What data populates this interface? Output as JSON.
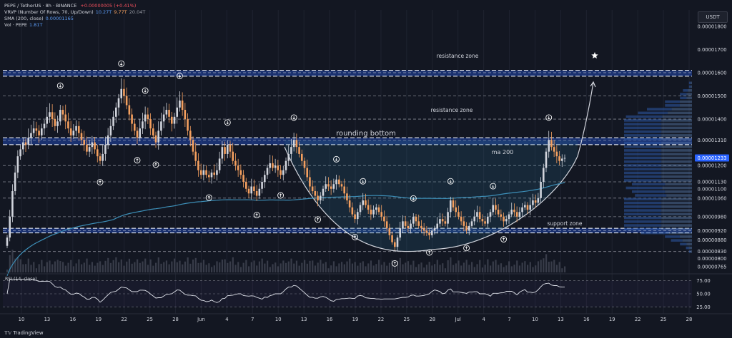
{
  "legend": {
    "title": "PEPE / TetherUS · 8h · BINANCE",
    "change": "+0.00000005 (+0.41%)",
    "vrvp_label": "VRVP (Number Of Rows, 70, Up/Down)",
    "vrvp_values": [
      "10.27T",
      "9.77T",
      "20.04T"
    ],
    "sma_label": "SMA (200, close)",
    "sma_value": "0.00001165",
    "vol_label": "Vol · PEPE",
    "vol_value": "1.81T"
  },
  "branding": {
    "logo_text": "TradingView"
  },
  "colors": {
    "up": "#d1d4dc",
    "down": "#f5a05f",
    "sma": "#3d8fb8",
    "zone": "#2962ff",
    "background": "#131722",
    "price_tag": "#2962ff"
  },
  "chart_data": {
    "type": "candlestick",
    "price_axis_unit": "USDT",
    "price_ticks": [
      "0.00001800",
      "0.00001700",
      "0.00001600",
      "0.00001500",
      "0.00001400",
      "0.00001310",
      "0.00001233",
      "0.00001200",
      "0.00001130",
      "0.00001100",
      "0.00001060",
      "0.00000980",
      "0.00000920",
      "0.00000880",
      "0.00000830",
      "0.00000800",
      "0.00000765"
    ],
    "current_price": "0.00001233",
    "ylim": [
      7.4e-06,
      1.87e-05
    ],
    "x_ticks": [
      "10",
      "13",
      "16",
      "19",
      "22",
      "25",
      "28",
      "Jun",
      "4",
      "7",
      "10",
      "13",
      "16",
      "19",
      "22",
      "25",
      "28",
      "Jul",
      "4",
      "7",
      "10",
      "13",
      "16",
      "19",
      "22",
      "25",
      "28"
    ],
    "horizontal_levels": [
      1.6e-05,
      1.5e-05,
      1.4e-05,
      1.31e-05,
      1.2e-05,
      1.13e-05,
      1.06e-05,
      9.8e-06,
      9.2e-06,
      8.3e-06
    ],
    "zones": [
      {
        "label": "resistance zone",
        "low": 1.585e-05,
        "high": 1.61e-05
      },
      {
        "label": "resistance zone",
        "low": 1.29e-05,
        "high": 1.32e-05
      },
      {
        "label": "support zone",
        "low": 9.1e-06,
        "high": 9.3e-06
      }
    ],
    "pattern_label": "rounding bottom",
    "ma_label": "ma 200",
    "closes": [
      8.9,
      9.8,
      10.9,
      11.7,
      12.4,
      12.7,
      13.0,
      12.9,
      13.2,
      13.4,
      13.6,
      13.5,
      13.3,
      13.6,
      13.8,
      14.1,
      14.3,
      14.0,
      13.7,
      13.9,
      14.4,
      14.2,
      13.9,
      13.6,
      13.3,
      13.5,
      13.7,
      13.4,
      13.1,
      12.9,
      12.6,
      12.8,
      13.0,
      12.7,
      12.4,
      12.2,
      12.5,
      12.9,
      13.3,
      13.7,
      14.1,
      14.5,
      14.9,
      15.3,
      15.0,
      14.6,
      14.2,
      13.8,
      13.5,
      13.2,
      13.6,
      13.9,
      14.2,
      14.0,
      13.6,
      13.3,
      13.0,
      13.5,
      13.9,
      14.2,
      14.4,
      14.1,
      13.8,
      14.1,
      14.5,
      14.8,
      14.4,
      14.0,
      13.5,
      13.1,
      12.6,
      12.2,
      11.8,
      11.6,
      11.8,
      11.6,
      11.5,
      11.7,
      11.6,
      11.8,
      12.3,
      12.8,
      12.5,
      12.9,
      12.6,
      12.2,
      12.0,
      11.8,
      11.6,
      11.3,
      11.0,
      10.8,
      11.1,
      10.9,
      10.7,
      11.0,
      11.3,
      11.6,
      11.9,
      12.1,
      11.9,
      12.0,
      11.8,
      11.6,
      11.8,
      12.2,
      12.5,
      12.8,
      13.1,
      12.8,
      12.5,
      12.2,
      11.9,
      11.5,
      11.1,
      10.9,
      10.7,
      10.5,
      10.7,
      11.0,
      11.2,
      11.1,
      11.0,
      11.2,
      11.4,
      11.2,
      11.1,
      10.8,
      10.5,
      10.2,
      9.9,
      9.7,
      10.0,
      10.3,
      10.5,
      10.3,
      10.1,
      9.9,
      10.1,
      10.2,
      10.0,
      9.8,
      9.6,
      9.3,
      9.0,
      8.7,
      8.5,
      8.9,
      9.3,
      9.6,
      9.4,
      9.3,
      9.5,
      9.8,
      9.6,
      9.4,
      9.3,
      9.2,
      9.1,
      9.0,
      9.2,
      9.3,
      9.5,
      9.7,
      9.6,
      9.5,
      10.0,
      10.5,
      10.2,
      10.0,
      9.8,
      9.6,
      9.4,
      9.2,
      9.4,
      9.6,
      9.8,
      10.0,
      9.7,
      9.6,
      9.5,
      9.8,
      10.0,
      10.3,
      10.1,
      9.9,
      9.8,
      9.6,
      9.7,
      9.9,
      10.1,
      10.0,
      9.8,
      10.0,
      10.2,
      10.3,
      10.1,
      10.3,
      10.5,
      10.4,
      10.6,
      11.3,
      11.9,
      12.6,
      13.1,
      12.8,
      12.6,
      12.4,
      12.2,
      12.3,
      12.33
    ],
    "rsi": {
      "label": "RSI (14, close)",
      "ticks": [
        75.0,
        50.0,
        25.0
      ]
    }
  }
}
